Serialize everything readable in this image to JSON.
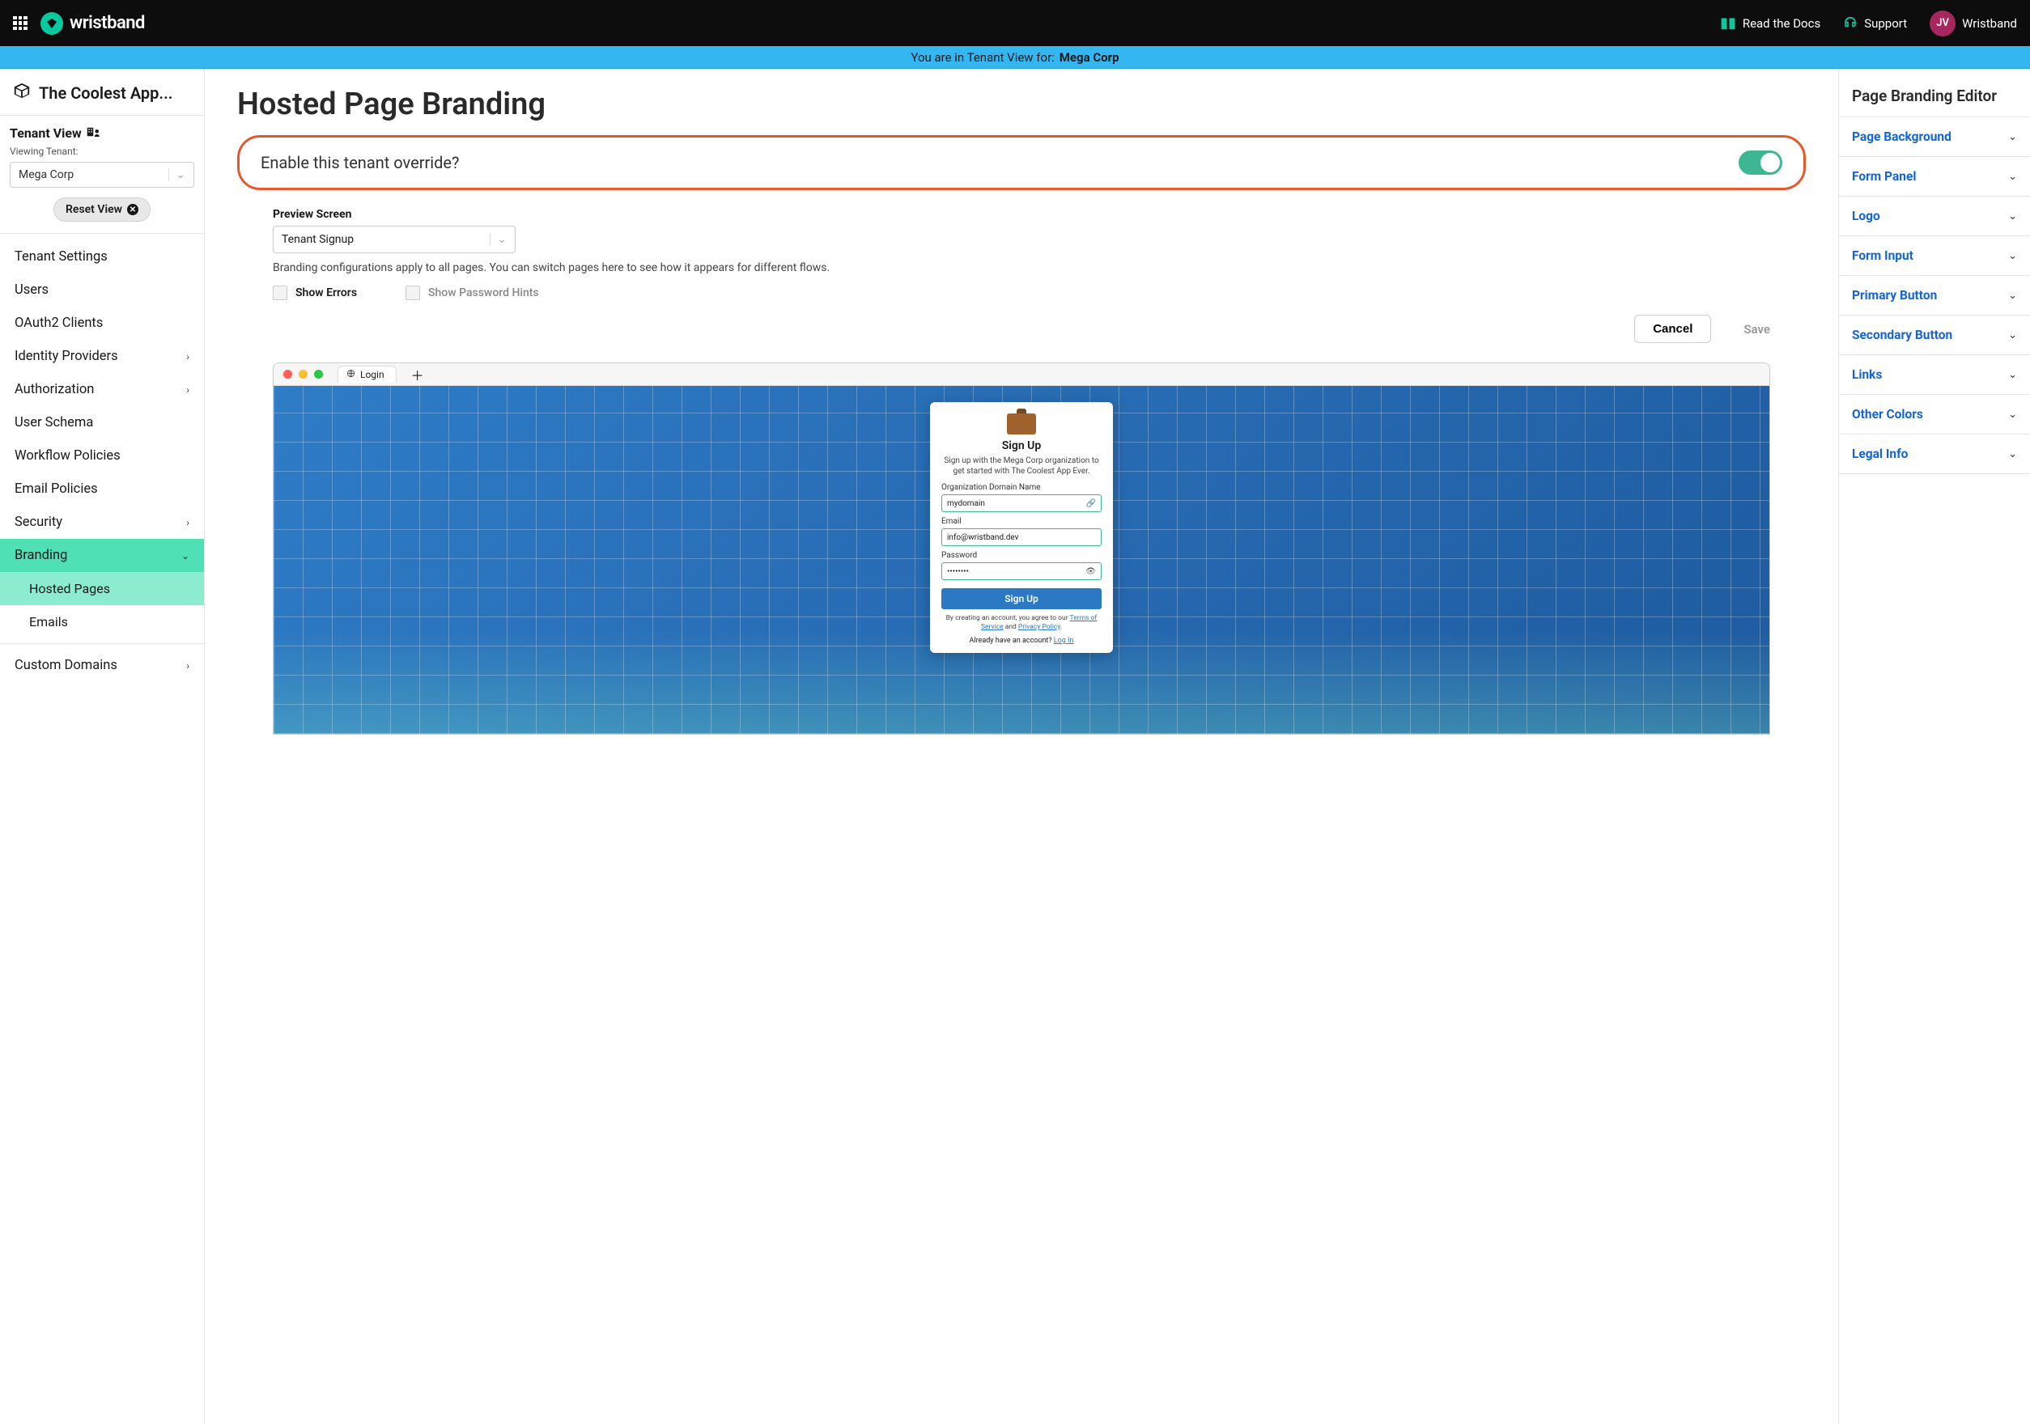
{
  "topbar": {
    "brand": "wristband",
    "docs": "Read the Docs",
    "support": "Support",
    "workspace": "Wristband",
    "avatar_initials": "JV"
  },
  "banner": {
    "prefix": "You are in Tenant View for:",
    "tenant": "Mega Corp"
  },
  "sidebar": {
    "app_name": "The Coolest App...",
    "tenant_view_title": "Tenant View",
    "viewing_label": "Viewing Tenant:",
    "selected_tenant": "Mega Corp",
    "reset_label": "Reset View",
    "nav": {
      "tenant_settings": "Tenant Settings",
      "users": "Users",
      "oauth": "OAuth2 Clients",
      "idp": "Identity Providers",
      "authorization": "Authorization",
      "user_schema": "User Schema",
      "workflow": "Workflow Policies",
      "email_policies": "Email Policies",
      "security": "Security",
      "branding": "Branding",
      "hosted_pages": "Hosted Pages",
      "emails": "Emails",
      "custom_domains": "Custom Domains"
    }
  },
  "main": {
    "title": "Hosted Page Branding",
    "enable_label": "Enable this tenant override?",
    "preview_label": "Preview Screen",
    "preview_value": "Tenant Signup",
    "help": "Branding configurations apply to all pages. You can switch pages here to see how it appears for different flows.",
    "show_errors": "Show Errors",
    "show_hints": "Show Password Hints",
    "cancel": "Cancel",
    "save": "Save",
    "browser": {
      "tab_label": "Login",
      "card": {
        "title": "Sign Up",
        "subtitle": "Sign up with the Mega Corp organization to get started with The Coolest App Ever.",
        "domain_label": "Organization Domain Name",
        "domain_value": "mydomain",
        "email_label": "Email",
        "email_value": "info@wristband.dev",
        "password_label": "Password",
        "password_value": "••••••••",
        "button": "Sign Up",
        "legal_pre": "By creating an account, you agree to our ",
        "legal_tos": "Terms of Service",
        "legal_and": " and ",
        "legal_pp": "Privacy Policy",
        "already_q": "Already have an account? ",
        "login_link": "Log In"
      }
    }
  },
  "editor": {
    "title": "Page Branding Editor",
    "items": {
      "bg": "Page Background",
      "panel": "Form Panel",
      "logo": "Logo",
      "input": "Form Input",
      "primary": "Primary Button",
      "secondary": "Secondary Button",
      "links": "Links",
      "other": "Other Colors",
      "legal": "Legal Info"
    }
  }
}
